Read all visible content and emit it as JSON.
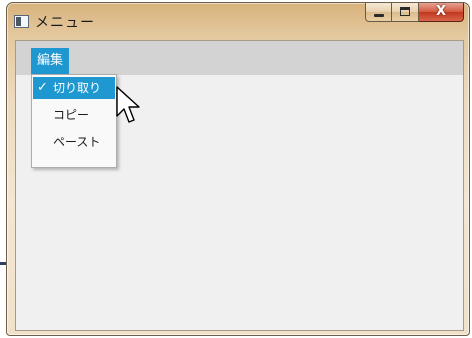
{
  "window": {
    "title": "メニュー",
    "icon": "app-window-icon",
    "caption_buttons": {
      "minimize_icon": "minimize-icon",
      "maximize_icon": "maximize-icon",
      "close_glyph": "X"
    }
  },
  "menubar": {
    "items": [
      {
        "label": "編集",
        "active": true
      }
    ]
  },
  "dropdown": {
    "items": [
      {
        "label": "切り取り",
        "checked": true,
        "highlighted": true
      },
      {
        "label": "コピー",
        "checked": false,
        "highlighted": false
      },
      {
        "label": "ペースト",
        "checked": false,
        "highlighted": false
      }
    ],
    "check_glyph": "✓"
  },
  "colors": {
    "highlight": "#1f97d0",
    "menubar": "#d3d3d3",
    "client": "#f0f0f0"
  }
}
